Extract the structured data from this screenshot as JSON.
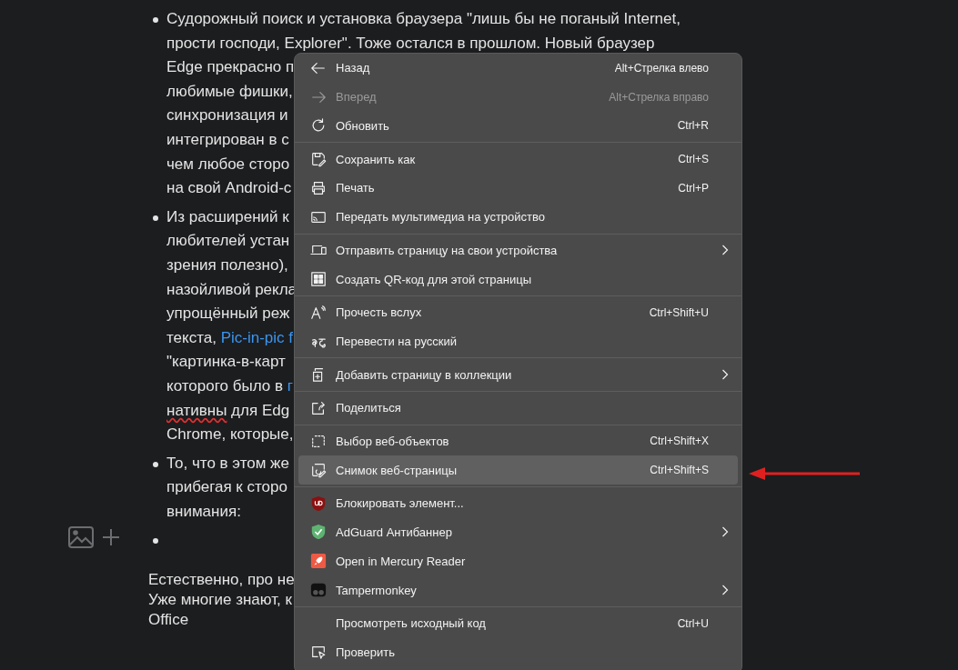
{
  "article": {
    "bullets": [
      {
        "lines": [
          [
            {
              "text": "Судорожный поиск и установка браузера \"лишь бы не поганый Internet,",
              "kind": "plain"
            }
          ],
          [
            {
              "text": "прости господи, Explorer\". Тоже остался в прошлом. Новый браузер",
              "kind": "plain"
            }
          ],
          [
            {
              "text": "Edge прекрасно п",
              "kind": "plain"
            }
          ],
          [
            {
              "text": "любимые фишки,",
              "kind": "plain"
            }
          ],
          [
            {
              "text": "синхронизация и",
              "kind": "plain"
            }
          ],
          [
            {
              "text": "интегрирован в с",
              "kind": "plain"
            }
          ],
          [
            {
              "text": "чем любое сторо",
              "kind": "plain"
            }
          ],
          [
            {
              "text": "на свой Android-с",
              "kind": "plain"
            }
          ]
        ]
      },
      {
        "lines": [
          [
            {
              "text": "Из расширений к",
              "kind": "plain"
            }
          ],
          [
            {
              "text": "любителей устан",
              "kind": "plain"
            }
          ],
          [
            {
              "text": "зрения полезно),",
              "kind": "plain"
            }
          ],
          [
            {
              "text": "назойливой рекла",
              "kind": "plain"
            }
          ],
          [
            {
              "text": "упрощённый реж",
              "kind": "plain"
            }
          ],
          [
            {
              "text": "текста, ",
              "kind": "plain"
            },
            {
              "text": "Pic-in-pic f",
              "kind": "link"
            }
          ],
          [
            {
              "text": "\"картинка-в-карт",
              "kind": "plain"
            }
          ],
          [
            {
              "text": "которого было в ",
              "kind": "plain"
            },
            {
              "text": "г",
              "kind": "link"
            }
          ],
          [
            {
              "text": "нативны",
              "kind": "misspelled"
            },
            {
              "text": " для Edg",
              "kind": "plain"
            }
          ],
          [
            {
              "text": "Chrome, которые,",
              "kind": "plain"
            }
          ]
        ]
      },
      {
        "lines": [
          [
            {
              "text": "То, что в этом же",
              "kind": "plain"
            }
          ],
          [
            {
              "text": "прибегая к сторо",
              "kind": "plain"
            }
          ],
          [
            {
              "text": "внимания:",
              "kind": "plain"
            }
          ]
        ]
      },
      {
        "kind": "empty"
      }
    ],
    "paragraph": [
      "Естественно, про не",
      "Уже многие знают, к",
      "Office"
    ]
  },
  "context_menu": {
    "groups": [
      [
        {
          "label": "Назад",
          "shortcut": "Alt+Стрелка влево",
          "disabled": false,
          "selected": false,
          "submenu": false
        },
        {
          "label": "Вперед",
          "shortcut": "Alt+Стрелка вправо",
          "disabled": true,
          "selected": false,
          "submenu": false
        },
        {
          "label": "Обновить",
          "shortcut": "Ctrl+R",
          "disabled": false,
          "selected": false,
          "submenu": false
        }
      ],
      [
        {
          "label": "Сохранить как",
          "shortcut": "Ctrl+S",
          "disabled": false,
          "selected": false,
          "submenu": false
        },
        {
          "label": "Печать",
          "shortcut": "Ctrl+P",
          "disabled": false,
          "selected": false,
          "submenu": false
        },
        {
          "label": "Передать мультимедиа на устройство",
          "disabled": false,
          "selected": false,
          "submenu": false
        }
      ],
      [
        {
          "label": "Отправить страницу на свои устройства",
          "disabled": false,
          "selected": false,
          "submenu": true
        },
        {
          "label": "Создать QR-код для этой страницы",
          "disabled": false,
          "selected": false,
          "submenu": false
        }
      ],
      [
        {
          "label": "Прочесть вслух",
          "shortcut": "Ctrl+Shift+U",
          "disabled": false,
          "selected": false,
          "submenu": false
        },
        {
          "label": "Перевести на русский",
          "disabled": false,
          "selected": false,
          "submenu": false
        }
      ],
      [
        {
          "label": "Добавить страницу в коллекции",
          "disabled": false,
          "selected": false,
          "submenu": true
        }
      ],
      [
        {
          "label": "Поделиться",
          "disabled": false,
          "selected": false,
          "submenu": false
        }
      ],
      [
        {
          "label": "Выбор веб-объектов",
          "shortcut": "Ctrl+Shift+X",
          "disabled": false,
          "selected": false,
          "submenu": false
        },
        {
          "label": "Снимок веб-страницы",
          "shortcut": "Ctrl+Shift+S",
          "disabled": false,
          "selected": true,
          "submenu": false
        }
      ],
      [
        {
          "label": "Блокировать элемент...",
          "disabled": false,
          "selected": false,
          "submenu": false
        },
        {
          "label": "AdGuard Антибаннер",
          "disabled": false,
          "selected": false,
          "submenu": true
        },
        {
          "label": "Open in Mercury Reader",
          "disabled": false,
          "selected": false,
          "submenu": false
        },
        {
          "label": "Tampermonkey",
          "disabled": false,
          "selected": false,
          "submenu": true
        }
      ],
      [
        {
          "label": "Просмотреть исходный код",
          "shortcut": "Ctrl+U",
          "disabled": false,
          "selected": false,
          "submenu": false
        },
        {
          "label": "Проверить",
          "disabled": false,
          "selected": false,
          "submenu": false
        }
      ]
    ]
  }
}
